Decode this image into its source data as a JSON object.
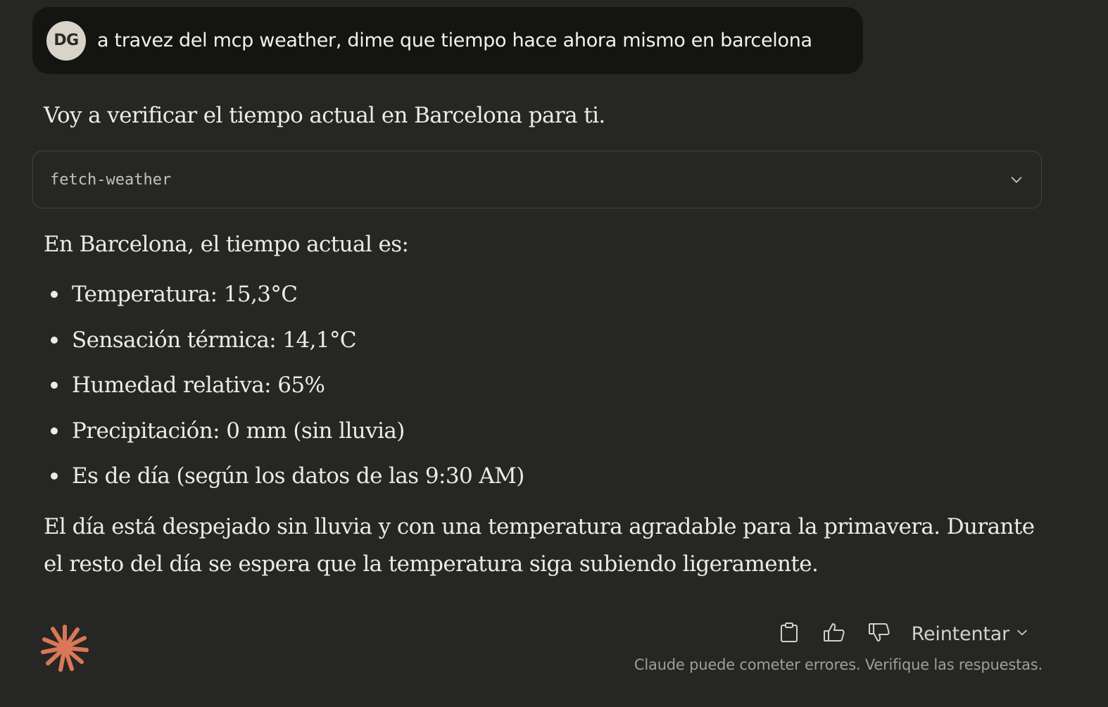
{
  "user_message": {
    "avatar_initials": "DG",
    "text": "a travez del mcp weather, dime que tiempo hace ahora mismo en barcelona"
  },
  "assistant": {
    "intro": "Voy a verificar el tiempo actual en Barcelona para ti.",
    "tool_call": {
      "name": "fetch-weather",
      "toggle_icon": "chevron-down-icon"
    },
    "summary": "En Barcelona, el tiempo actual es:",
    "bullets": [
      "Temperatura: 15,3°C",
      "Sensación térmica: 14,1°C",
      "Humedad relativa: 65%",
      "Precipitación: 0 mm (sin lluvia)",
      "Es de día (según los datos de las 9:30 AM)"
    ],
    "closing": "El día está despejado sin lluvia y con una temperatura agradable para la primavera. Durante el resto del día se espera que la temperatura siga subiendo ligeramente."
  },
  "footer": {
    "logo_icon": "claude-starburst-icon",
    "actions": {
      "copy_icon": "clipboard-icon",
      "like_icon": "thumbs-up-icon",
      "dislike_icon": "thumbs-down-icon",
      "retry_label": "Reintentar"
    },
    "disclaimer": "Claude puede cometer errores. Verifique las respuestas."
  },
  "colors": {
    "background": "#262624",
    "user_bubble": "#141413",
    "avatar_bg": "#D8D4C9",
    "text_primary": "#ECEBE6",
    "border": "#45443F",
    "brand_accent": "#D97757",
    "muted_text": "#A09E96"
  }
}
